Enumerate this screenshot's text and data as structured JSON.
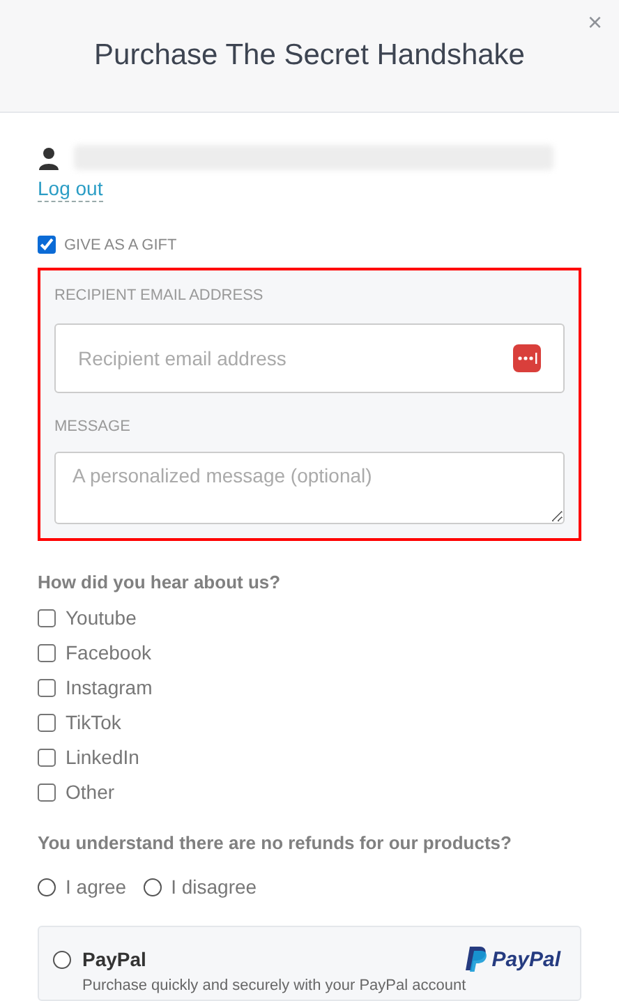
{
  "dialog": {
    "title": "Purchase The Secret Handshake",
    "close": "×"
  },
  "account": {
    "logout": "Log out"
  },
  "gift": {
    "label": "GIVE AS A GIFT",
    "checked": true,
    "highlighted": true,
    "email": {
      "label": "RECIPIENT EMAIL ADDRESS",
      "placeholder": "Recipient email address"
    },
    "message": {
      "label": "MESSAGE",
      "placeholder": "A personalized message (optional)"
    }
  },
  "survey": {
    "question": "How did you hear about us?",
    "options": [
      {
        "label": "Youtube",
        "checked": false
      },
      {
        "label": "Facebook",
        "checked": false
      },
      {
        "label": "Instagram",
        "checked": false
      },
      {
        "label": "TikTok",
        "checked": false
      },
      {
        "label": "LinkedIn",
        "checked": false
      },
      {
        "label": "Other",
        "checked": false
      }
    ]
  },
  "refunds": {
    "question": "You understand there are no refunds for our products?",
    "options": [
      {
        "label": "I agree",
        "selected": false
      },
      {
        "label": "I disagree",
        "selected": false
      }
    ]
  },
  "payment": [
    {
      "name": "PayPal",
      "logo": "PayPal",
      "selected": false,
      "description": "Purchase quickly and securely with your PayPal account"
    }
  ]
}
